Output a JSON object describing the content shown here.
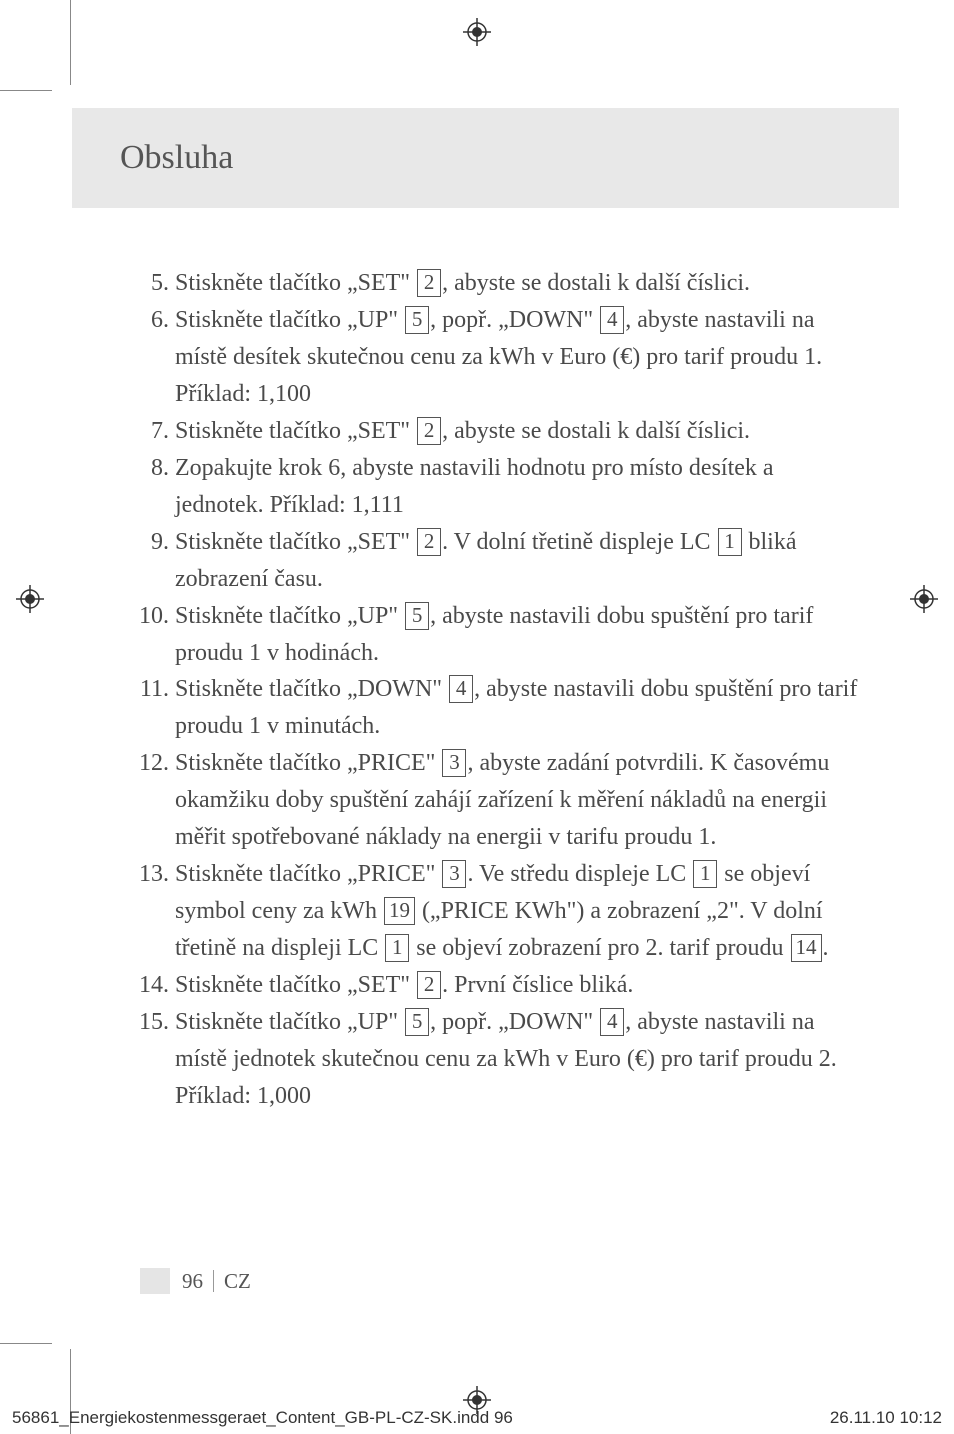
{
  "header": {
    "title": "Obsluha"
  },
  "steps": [
    {
      "num": "5.",
      "parts": [
        "Stiskněte tlačítko „SET\" ",
        {
          "box": "2"
        },
        ", abyste se dostali k další číslici."
      ]
    },
    {
      "num": "6.",
      "parts": [
        "Stiskněte tlačítko „UP\" ",
        {
          "box": "5"
        },
        ", popř. „DOWN\" ",
        {
          "box": "4"
        },
        ", abyste nastavili na místě desítek skutečnou cenu za kWh v Euro (€) pro tarif proudu 1. Příklad: 1,100"
      ]
    },
    {
      "num": "7.",
      "parts": [
        "Stiskněte tlačítko „SET\" ",
        {
          "box": "2"
        },
        ", abyste se dostali k další číslici."
      ]
    },
    {
      "num": "8.",
      "parts": [
        "Zopakujte krok 6, abyste nastavili hodnotu pro místo desítek a jednotek. Příklad: 1,111"
      ]
    },
    {
      "num": "9.",
      "parts": [
        "Stiskněte tlačítko „SET\" ",
        {
          "box": "2"
        },
        ". V dolní třetině displeje LC ",
        {
          "box": "1"
        },
        " bliká zobrazení času."
      ]
    },
    {
      "num": "10.",
      "parts": [
        "Stiskněte tlačítko „UP\" ",
        {
          "box": "5"
        },
        ", abyste nastavili dobu spuštění pro tarif proudu 1 v hodinách."
      ]
    },
    {
      "num": "11.",
      "parts": [
        "Stiskněte tlačítko „DOWN\" ",
        {
          "box": "4"
        },
        ", abyste nastavili dobu spuštění pro tarif proudu 1 v minutách."
      ]
    },
    {
      "num": "12.",
      "parts": [
        "Stiskněte tlačítko „PRICE\" ",
        {
          "box": "3"
        },
        ", abyste zadání potvrdili. K časovému okamžiku doby spuštění zahájí zařízení k měření nákladů na energii měřit spotřebované náklady na energii v tarifu proudu 1."
      ]
    },
    {
      "num": "13.",
      "parts": [
        "Stiskněte tlačítko „PRICE\" ",
        {
          "box": "3"
        },
        ". Ve středu displeje LC ",
        {
          "box": "1"
        },
        " se objeví symbol ceny za kWh ",
        {
          "box": "19"
        },
        " („PRICE KWh\") a zobrazení „2\". V dolní třetině na displeji LC ",
        {
          "box": "1"
        },
        " se objeví zobrazení pro 2. tarif proudu ",
        {
          "box": "14"
        },
        "."
      ]
    },
    {
      "num": "14.",
      "parts": [
        "Stiskněte tlačítko „SET\" ",
        {
          "box": "2"
        },
        ". První číslice bliká."
      ]
    },
    {
      "num": "15.",
      "parts": [
        "Stiskněte tlačítko „UP\" ",
        {
          "box": "5"
        },
        ", popř. „DOWN\" ",
        {
          "box": "4"
        },
        ", abyste nastavili na místě jednotek skutečnou cenu za kWh v Euro (€) pro tarif proudu 2. Příklad: 1,000"
      ]
    }
  ],
  "footer": {
    "page": "96",
    "lang": "CZ"
  },
  "bottom": {
    "filename": "56861_Energiekostenmessgeraet_Content_GB-PL-CZ-SK.indd   96",
    "timestamp": "26.11.10   10:12"
  }
}
